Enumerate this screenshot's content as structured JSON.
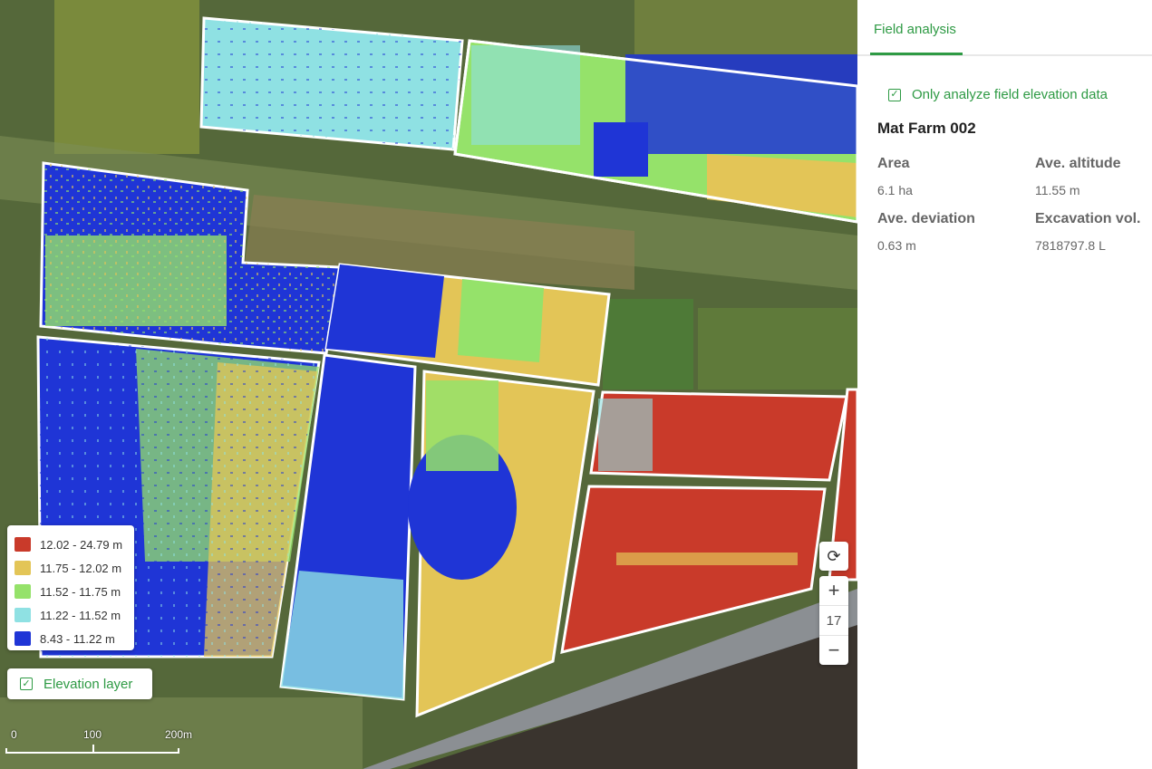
{
  "map": {
    "legend": [
      {
        "label": "12.02 - 24.79 m",
        "color": "#c93a2a"
      },
      {
        "label": "11.75 - 12.02 m",
        "color": "#e3c557"
      },
      {
        "label": "11.52 - 11.75 m",
        "color": "#95e26a"
      },
      {
        "label": "11.22 - 11.52 m",
        "color": "#8fe1e3"
      },
      {
        "label": "8.43 - 11.22 m",
        "color": "#1f35d6"
      }
    ],
    "elevation_layer_label": "Elevation layer",
    "scale": {
      "labels": [
        "0",
        "100",
        "200m"
      ]
    },
    "zoom_level": "17",
    "icons": {
      "refresh": "refresh-icon",
      "zoom_in": "plus-icon",
      "zoom_out": "minus-icon",
      "check": "check-icon"
    }
  },
  "panel": {
    "tab": "Field analysis",
    "analyze_option": "Only analyze field elevation data",
    "field_name": "Mat Farm 002",
    "stats": [
      {
        "title": "Area",
        "value": "6.1 ha"
      },
      {
        "title": "Ave. altitude",
        "value": "11.55 m"
      },
      {
        "title": "Ave. deviation",
        "value": "0.63 m"
      },
      {
        "title": "Excavation vol.",
        "value": "7818797.8 L"
      }
    ]
  },
  "colors": {
    "accent": "#2e9a44"
  }
}
